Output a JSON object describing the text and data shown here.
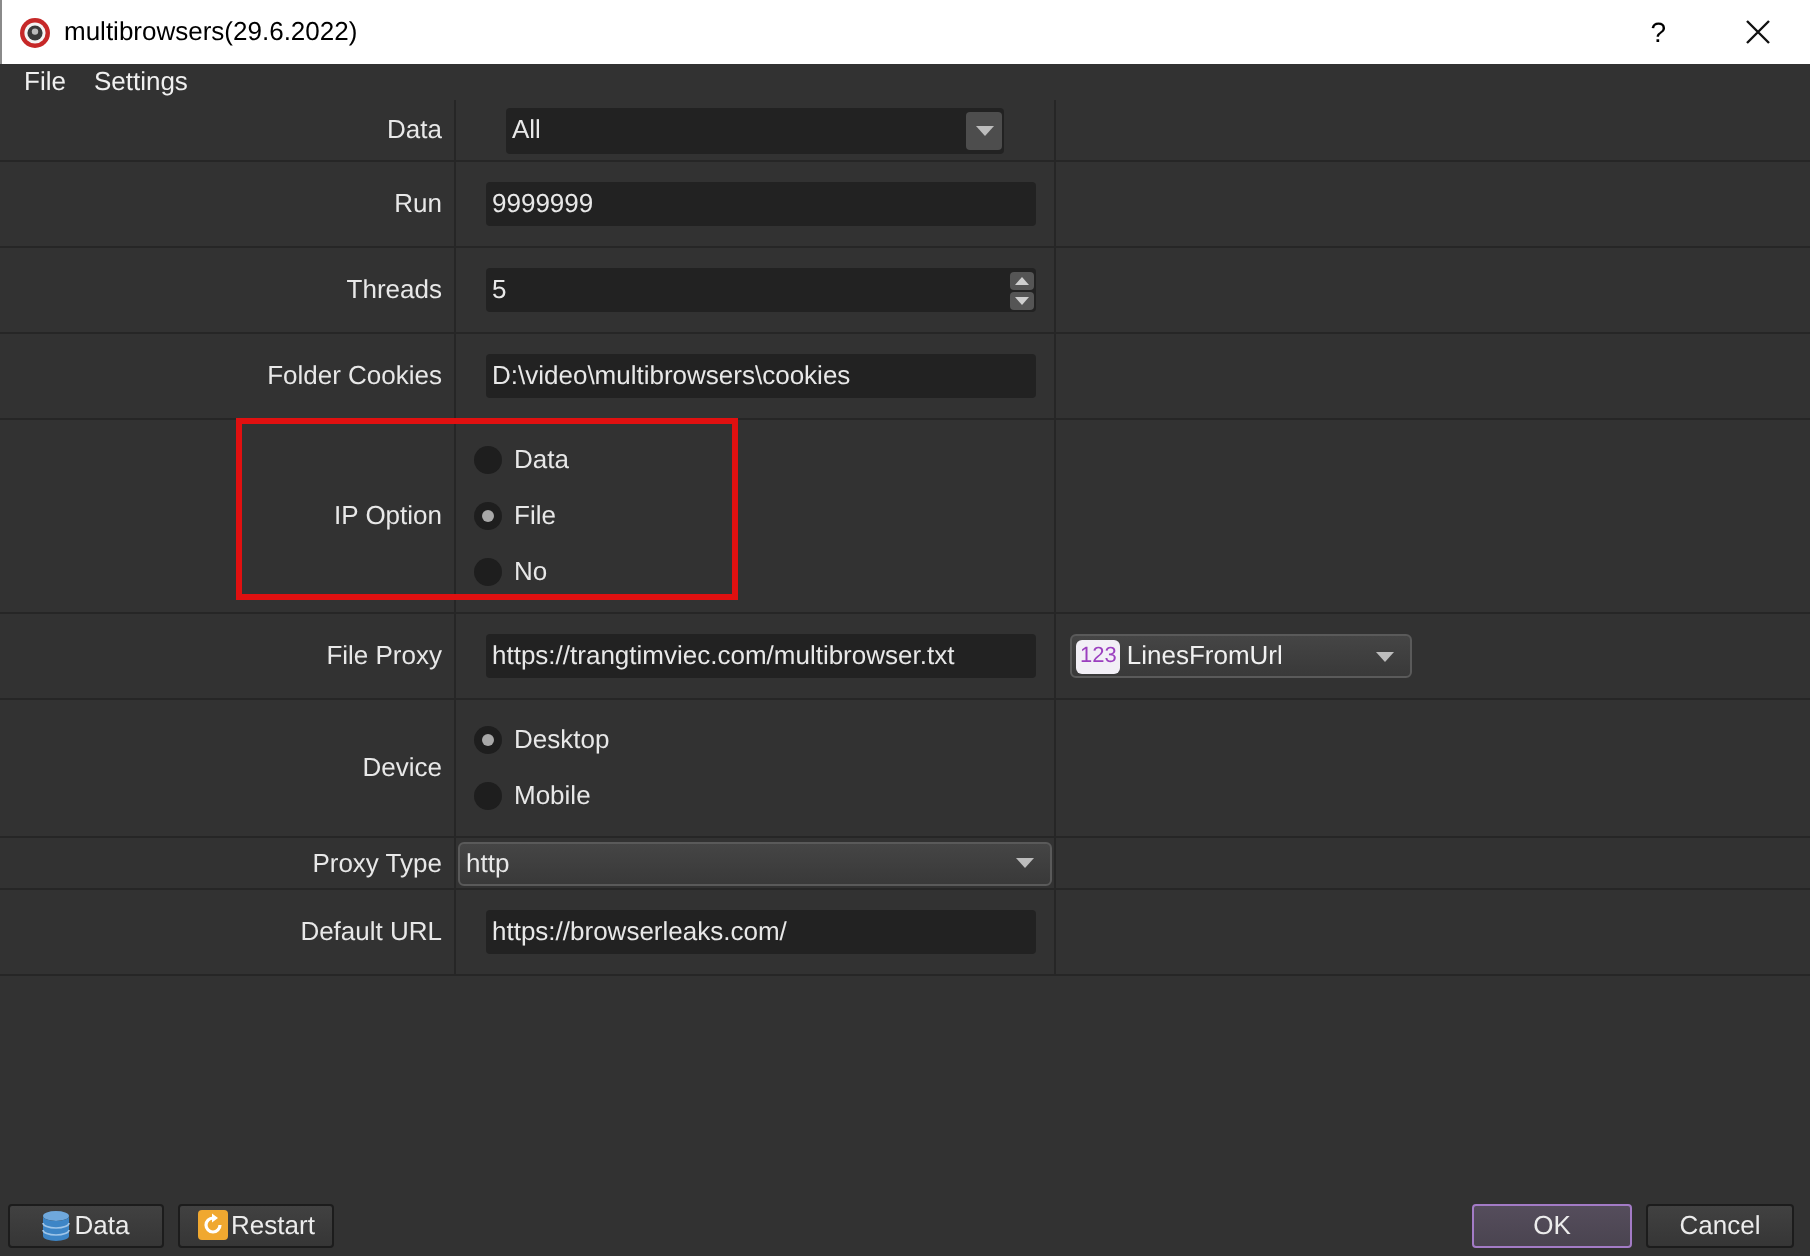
{
  "window": {
    "title": "multibrowsers(29.6.2022)",
    "help": "?"
  },
  "menu": [
    "File",
    "Settings"
  ],
  "form": {
    "rows": [
      {
        "label": "Data",
        "kind": "combo",
        "value": "All",
        "highlighted": false
      },
      {
        "label": "Run",
        "kind": "input",
        "value": "9999999",
        "highlighted": false
      },
      {
        "label": "Threads",
        "kind": "spin",
        "value": "5",
        "highlighted": false
      },
      {
        "label": "Folder Cookies",
        "kind": "input",
        "value": "D:\\video\\multibrowsers\\cookies",
        "highlighted": false
      },
      {
        "label": "IP Option",
        "kind": "radio",
        "highlighted": true,
        "options": [
          {
            "label": "Data",
            "selected": false
          },
          {
            "label": "File",
            "selected": true
          },
          {
            "label": "No",
            "selected": false
          }
        ]
      },
      {
        "label": "File Proxy",
        "kind": "input",
        "value": "https://trangtimviec.com/multibrowser.txt",
        "highlighted": false,
        "extra": {
          "badge": "123",
          "value": "LinesFromUrl"
        }
      },
      {
        "label": "Device",
        "kind": "radio",
        "highlighted": false,
        "options": [
          {
            "label": "Desktop",
            "selected": true
          },
          {
            "label": "Mobile",
            "selected": false
          }
        ]
      },
      {
        "label": "Proxy Type",
        "kind": "wide_combo",
        "value": "http",
        "highlighted": false
      },
      {
        "label": "Default URL",
        "kind": "input",
        "value": "https://browserleaks.com/",
        "highlighted": false
      }
    ]
  },
  "footer": {
    "data_button": "Data",
    "restart_button": "Restart",
    "ok_button": {
      "label": "OK",
      "focused": true
    },
    "cancel_button": {
      "label": "Cancel",
      "focused": false
    }
  }
}
